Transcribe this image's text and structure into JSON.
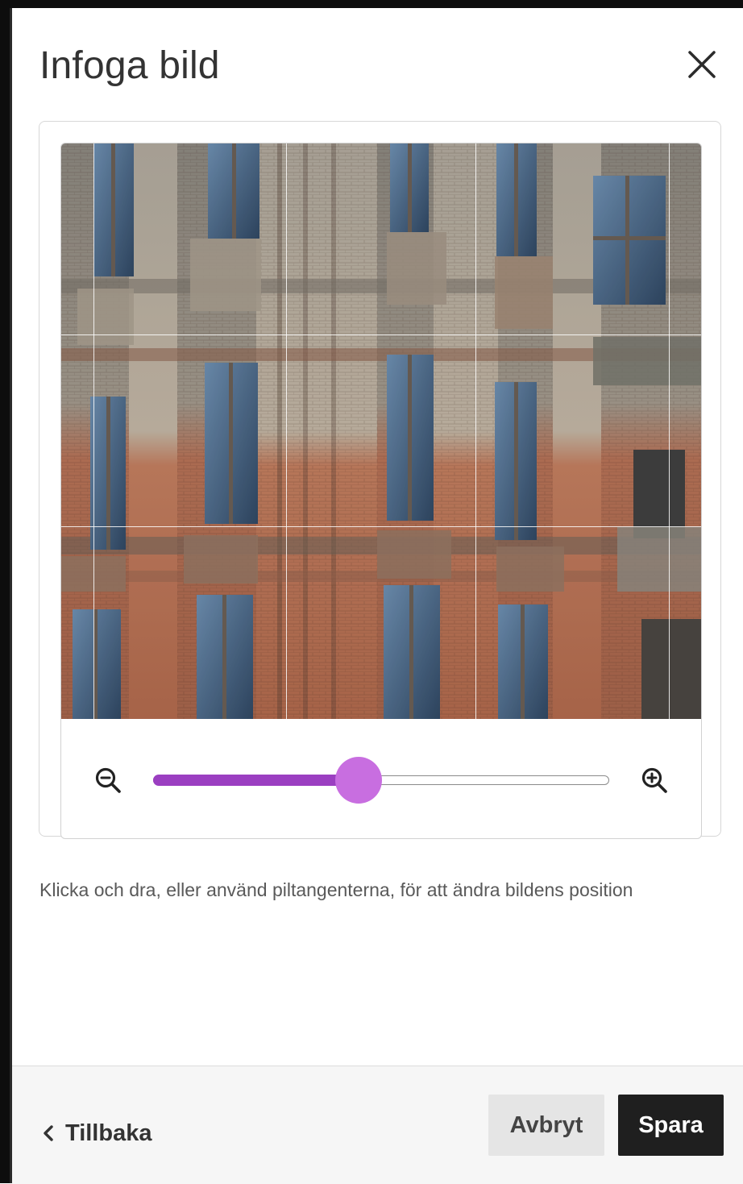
{
  "dialog": {
    "title": "Infoga bild",
    "close_icon": "close-icon"
  },
  "editor": {
    "image_alt": "building facade photo",
    "zoom_out_icon": "zoom-out-icon",
    "zoom_in_icon": "zoom-in-icon",
    "zoom_level": 0.45,
    "accent_color": "#9b3fc1",
    "thumb_color": "#c86ee0"
  },
  "hint": "Klicka och dra, eller använd piltangenterna, för att ändra bildens position",
  "footer": {
    "back_label": "Tillbaka",
    "back_icon": "chevron-left-icon",
    "cancel_label": "Avbryt",
    "save_label": "Spara"
  }
}
